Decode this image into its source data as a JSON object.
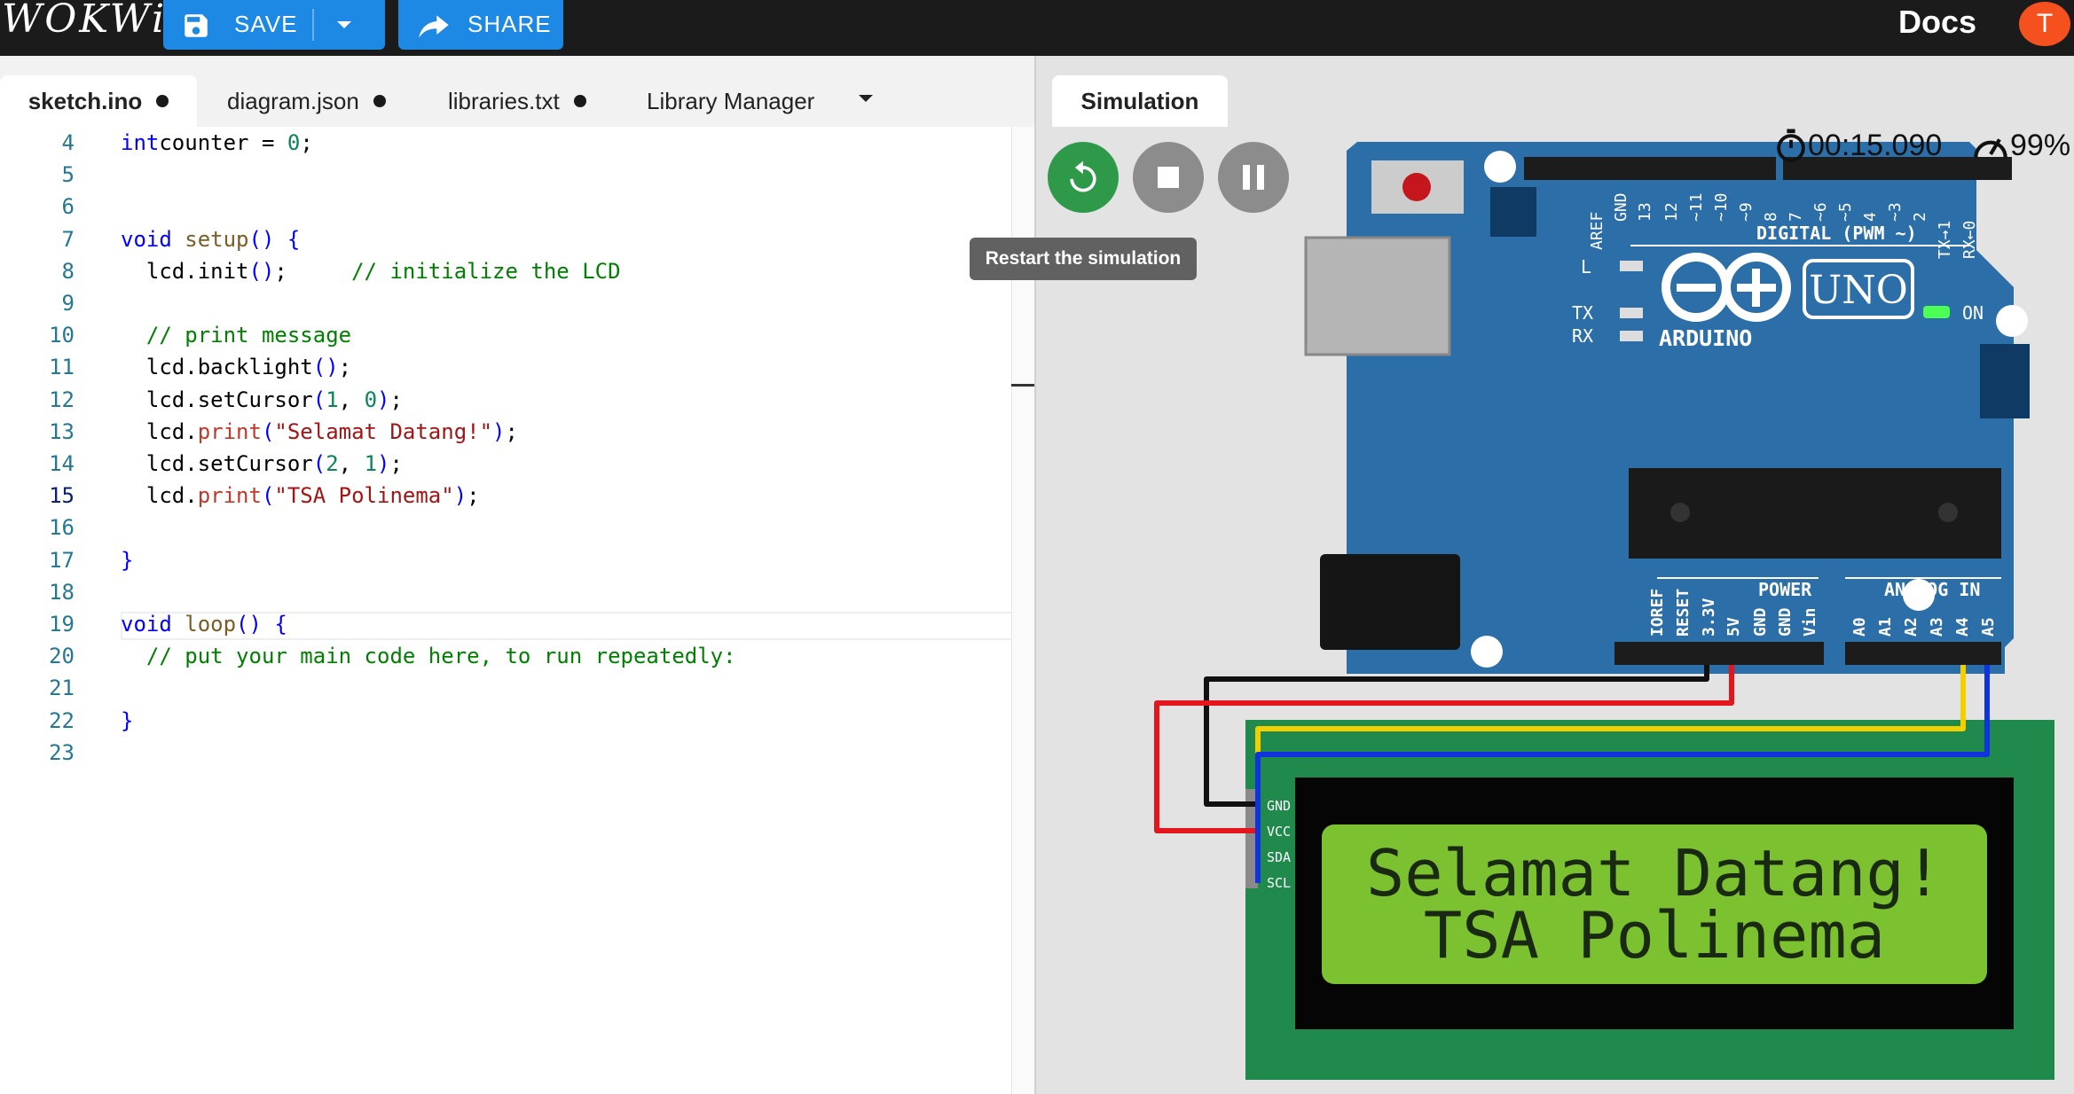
{
  "app": {
    "logo": "WOKWi",
    "save_label": "SAVE",
    "share_label": "SHARE",
    "docs_label": "Docs",
    "avatar_initial": "T"
  },
  "editor": {
    "tabs": [
      {
        "label": "sketch.ino",
        "modified": true,
        "active": true
      },
      {
        "label": "diagram.json",
        "modified": true
      },
      {
        "label": "libraries.txt",
        "modified": true
      },
      {
        "label": "Library Manager"
      }
    ],
    "current_line": 15,
    "lines": [
      {
        "n": "4",
        "tokens": [
          [
            "kw",
            "int"
          ],
          [
            "",
            "counter = "
          ],
          [
            "num",
            "0"
          ],
          [
            "",
            ";"
          ]
        ]
      },
      {
        "n": "5",
        "tokens": []
      },
      {
        "n": "6",
        "tokens": []
      },
      {
        "n": "7",
        "tokens": [
          [
            "kw",
            "void"
          ],
          [
            "",
            " "
          ],
          [
            "fn",
            "setup"
          ],
          [
            "kw",
            "()"
          ],
          [
            "",
            " "
          ],
          [
            "kw",
            "{"
          ]
        ]
      },
      {
        "n": "8",
        "tokens": [
          [
            "",
            "  lcd.init"
          ],
          [
            "kw",
            "()"
          ],
          [
            "",
            ";     "
          ],
          [
            "cm",
            "// initialize the LCD"
          ]
        ]
      },
      {
        "n": "9",
        "tokens": []
      },
      {
        "n": "10",
        "tokens": [
          [
            "",
            "  "
          ],
          [
            "cm",
            "// print message"
          ]
        ]
      },
      {
        "n": "11",
        "tokens": [
          [
            "",
            "  lcd.backlight"
          ],
          [
            "kw",
            "()"
          ],
          [
            "",
            ";"
          ]
        ]
      },
      {
        "n": "12",
        "tokens": [
          [
            "",
            "  lcd.setCursor"
          ],
          [
            "kw",
            "("
          ],
          [
            "num",
            "1"
          ],
          [
            "",
            ", "
          ],
          [
            "num",
            "0"
          ],
          [
            "kw",
            ")"
          ],
          [
            "",
            ";"
          ]
        ]
      },
      {
        "n": "13",
        "tokens": [
          [
            "",
            "  lcd."
          ],
          [
            "pr",
            "print"
          ],
          [
            "kw",
            "("
          ],
          [
            "str",
            "\"Selamat Datang!\""
          ],
          [
            "kw",
            ")"
          ],
          [
            "",
            ";"
          ]
        ]
      },
      {
        "n": "14",
        "tokens": [
          [
            "",
            "  lcd.setCursor"
          ],
          [
            "kw",
            "("
          ],
          [
            "num",
            "2"
          ],
          [
            "",
            ", "
          ],
          [
            "num",
            "1"
          ],
          [
            "kw",
            ")"
          ],
          [
            "",
            ";"
          ]
        ]
      },
      {
        "n": "15",
        "tokens": [
          [
            "",
            "  lcd."
          ],
          [
            "pr",
            "print"
          ],
          [
            "kw",
            "("
          ],
          [
            "str",
            "\"TSA Polinema\""
          ],
          [
            "kw",
            ")"
          ],
          [
            "",
            ";"
          ]
        ]
      },
      {
        "n": "16",
        "tokens": []
      },
      {
        "n": "17",
        "tokens": [
          [
            "kw",
            "}"
          ]
        ]
      },
      {
        "n": "18",
        "tokens": []
      },
      {
        "n": "19",
        "tokens": [
          [
            "kw",
            "void"
          ],
          [
            "",
            " "
          ],
          [
            "fn",
            "loop"
          ],
          [
            "kw",
            "()"
          ],
          [
            "",
            " "
          ],
          [
            "kw",
            "{"
          ]
        ]
      },
      {
        "n": "20",
        "tokens": [
          [
            "",
            "  "
          ],
          [
            "cm",
            "// put your main code here, to run repeatedly:"
          ]
        ]
      },
      {
        "n": "21",
        "tokens": []
      },
      {
        "n": "22",
        "tokens": [
          [
            "kw",
            "}"
          ]
        ]
      },
      {
        "n": "23",
        "tokens": []
      }
    ]
  },
  "simulation": {
    "tab_label": "Simulation",
    "tooltip": "Restart the simulation",
    "timer": "00:15.090",
    "speed": "99%",
    "colors": {
      "restart": "#2e9a49",
      "control": "#8c8c8c",
      "board": "#2b6ea8",
      "lcd_screen": "#7cc12f",
      "pcb": "#1f8a4c"
    },
    "board": {
      "brand": "ARDUINO",
      "model": "UNO",
      "on_label": "ON",
      "digital_label": "DIGITAL (PWM ~)",
      "aref": "AREF",
      "gnd": "GND",
      "l": "L",
      "tx": "TX",
      "rx": "RX",
      "digital_pins": [
        "13",
        "12",
        "~11",
        "~10",
        "~9",
        "8",
        "7",
        "~6",
        "~5",
        "4",
        "~3",
        "2",
        "TX→1",
        "RX←0"
      ],
      "power_label": "POWER",
      "analog_label": "ANALOG IN",
      "power_pins": [
        "IOREF",
        "RESET",
        "3.3V",
        "5V",
        "GND",
        "GND",
        "Vin"
      ],
      "analog_pins": [
        "A0",
        "A1",
        "A2",
        "A3",
        "A4",
        "A5"
      ]
    },
    "lcd": {
      "pins": [
        "GND",
        "VCC",
        "SDA",
        "SCL"
      ],
      "line1": "Selamat Datang!",
      "line2": "TSA Polinema"
    },
    "wires": [
      {
        "name": "gnd-wire",
        "color": "#111111"
      },
      {
        "name": "vcc-wire",
        "color": "#e3161e"
      },
      {
        "name": "sda-wire",
        "color": "#f2d000"
      },
      {
        "name": "scl-wire",
        "color": "#1033e0"
      }
    ]
  }
}
